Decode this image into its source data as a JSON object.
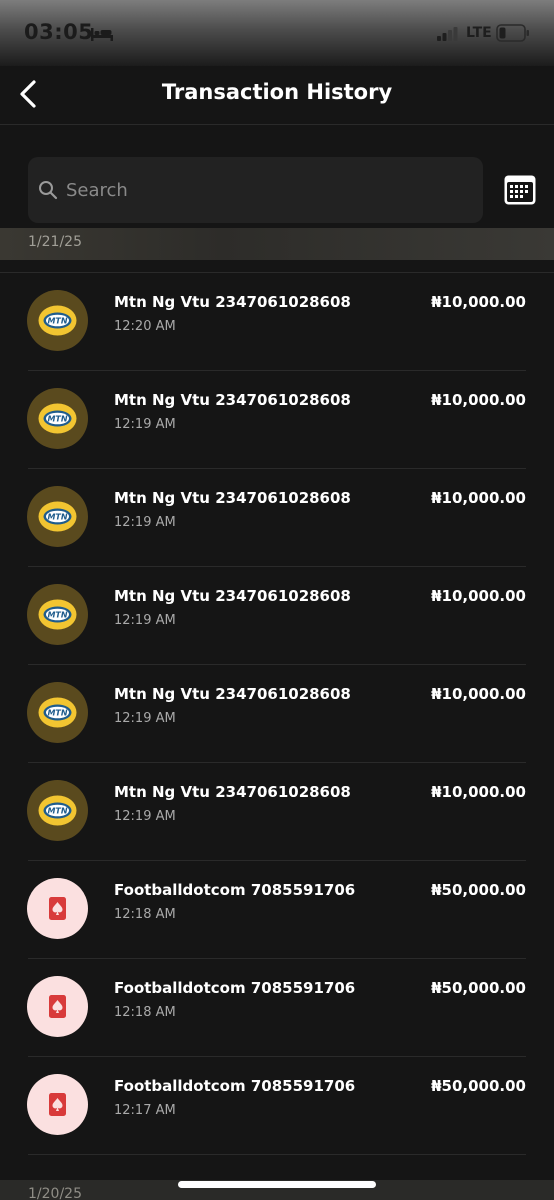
{
  "status_bar": {
    "time": "03:05",
    "network": "LTE"
  },
  "header": {
    "title": "Transaction History"
  },
  "search": {
    "placeholder": "Search"
  },
  "groups": [
    {
      "date": "1/21/25"
    },
    {
      "date": "1/20/25"
    }
  ],
  "transactions": [
    {
      "title": "Mtn Ng Vtu 2347061028608",
      "time": "12:20 AM",
      "amount": "₦10,000.00",
      "icon": "mtn-logo-icon"
    },
    {
      "title": "Mtn Ng Vtu 2347061028608",
      "time": "12:19 AM",
      "amount": "₦10,000.00",
      "icon": "mtn-logo-icon"
    },
    {
      "title": "Mtn Ng Vtu 2347061028608",
      "time": "12:19 AM",
      "amount": "₦10,000.00",
      "icon": "mtn-logo-icon"
    },
    {
      "title": "Mtn Ng Vtu 2347061028608",
      "time": "12:19 AM",
      "amount": "₦10,000.00",
      "icon": "mtn-logo-icon"
    },
    {
      "title": "Mtn Ng Vtu 2347061028608",
      "time": "12:19 AM",
      "amount": "₦10,000.00",
      "icon": "mtn-logo-icon"
    },
    {
      "title": "Mtn Ng Vtu 2347061028608",
      "time": "12:19 AM",
      "amount": "₦10,000.00",
      "icon": "mtn-logo-icon"
    },
    {
      "title": "Footballdotcom 7085591706",
      "time": "12:18 AM",
      "amount": "₦50,000.00",
      "icon": "betting-card-icon"
    },
    {
      "title": "Footballdotcom 7085591706",
      "time": "12:18 AM",
      "amount": "₦50,000.00",
      "icon": "betting-card-icon"
    },
    {
      "title": "Footballdotcom 7085591706",
      "time": "12:17 AM",
      "amount": "₦50,000.00",
      "icon": "betting-card-icon"
    }
  ],
  "colors": {
    "background": "#151515",
    "mtn_yellow": "#f2c531",
    "mtn_blue": "#1f5c8c",
    "bet_red": "#d83a3a",
    "bet_bg": "#fbe0e0"
  }
}
